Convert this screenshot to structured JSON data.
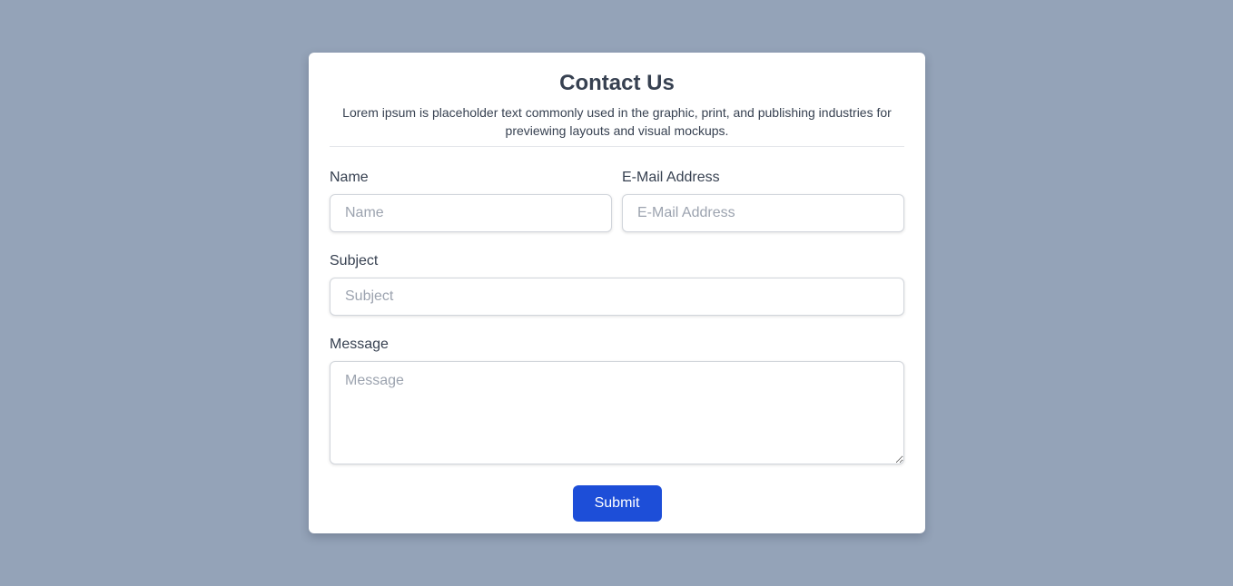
{
  "colors": {
    "page_background": "#94a3b8",
    "card_background": "#ffffff",
    "accent": "#1d4ed8",
    "text": "#374151",
    "placeholder": "#9ca3af"
  },
  "form": {
    "title": "Contact Us",
    "description": "Lorem ipsum is placeholder text commonly used in the graphic, print, and publishing industries for previewing layouts and visual mockups.",
    "fields": {
      "name": {
        "label": "Name",
        "placeholder": "Name",
        "value": ""
      },
      "email": {
        "label": "E-Mail Address",
        "placeholder": "E-Mail Address",
        "value": ""
      },
      "subject": {
        "label": "Subject",
        "placeholder": "Subject",
        "value": ""
      },
      "message": {
        "label": "Message",
        "placeholder": "Message",
        "value": ""
      }
    },
    "submit_label": "Submit"
  }
}
